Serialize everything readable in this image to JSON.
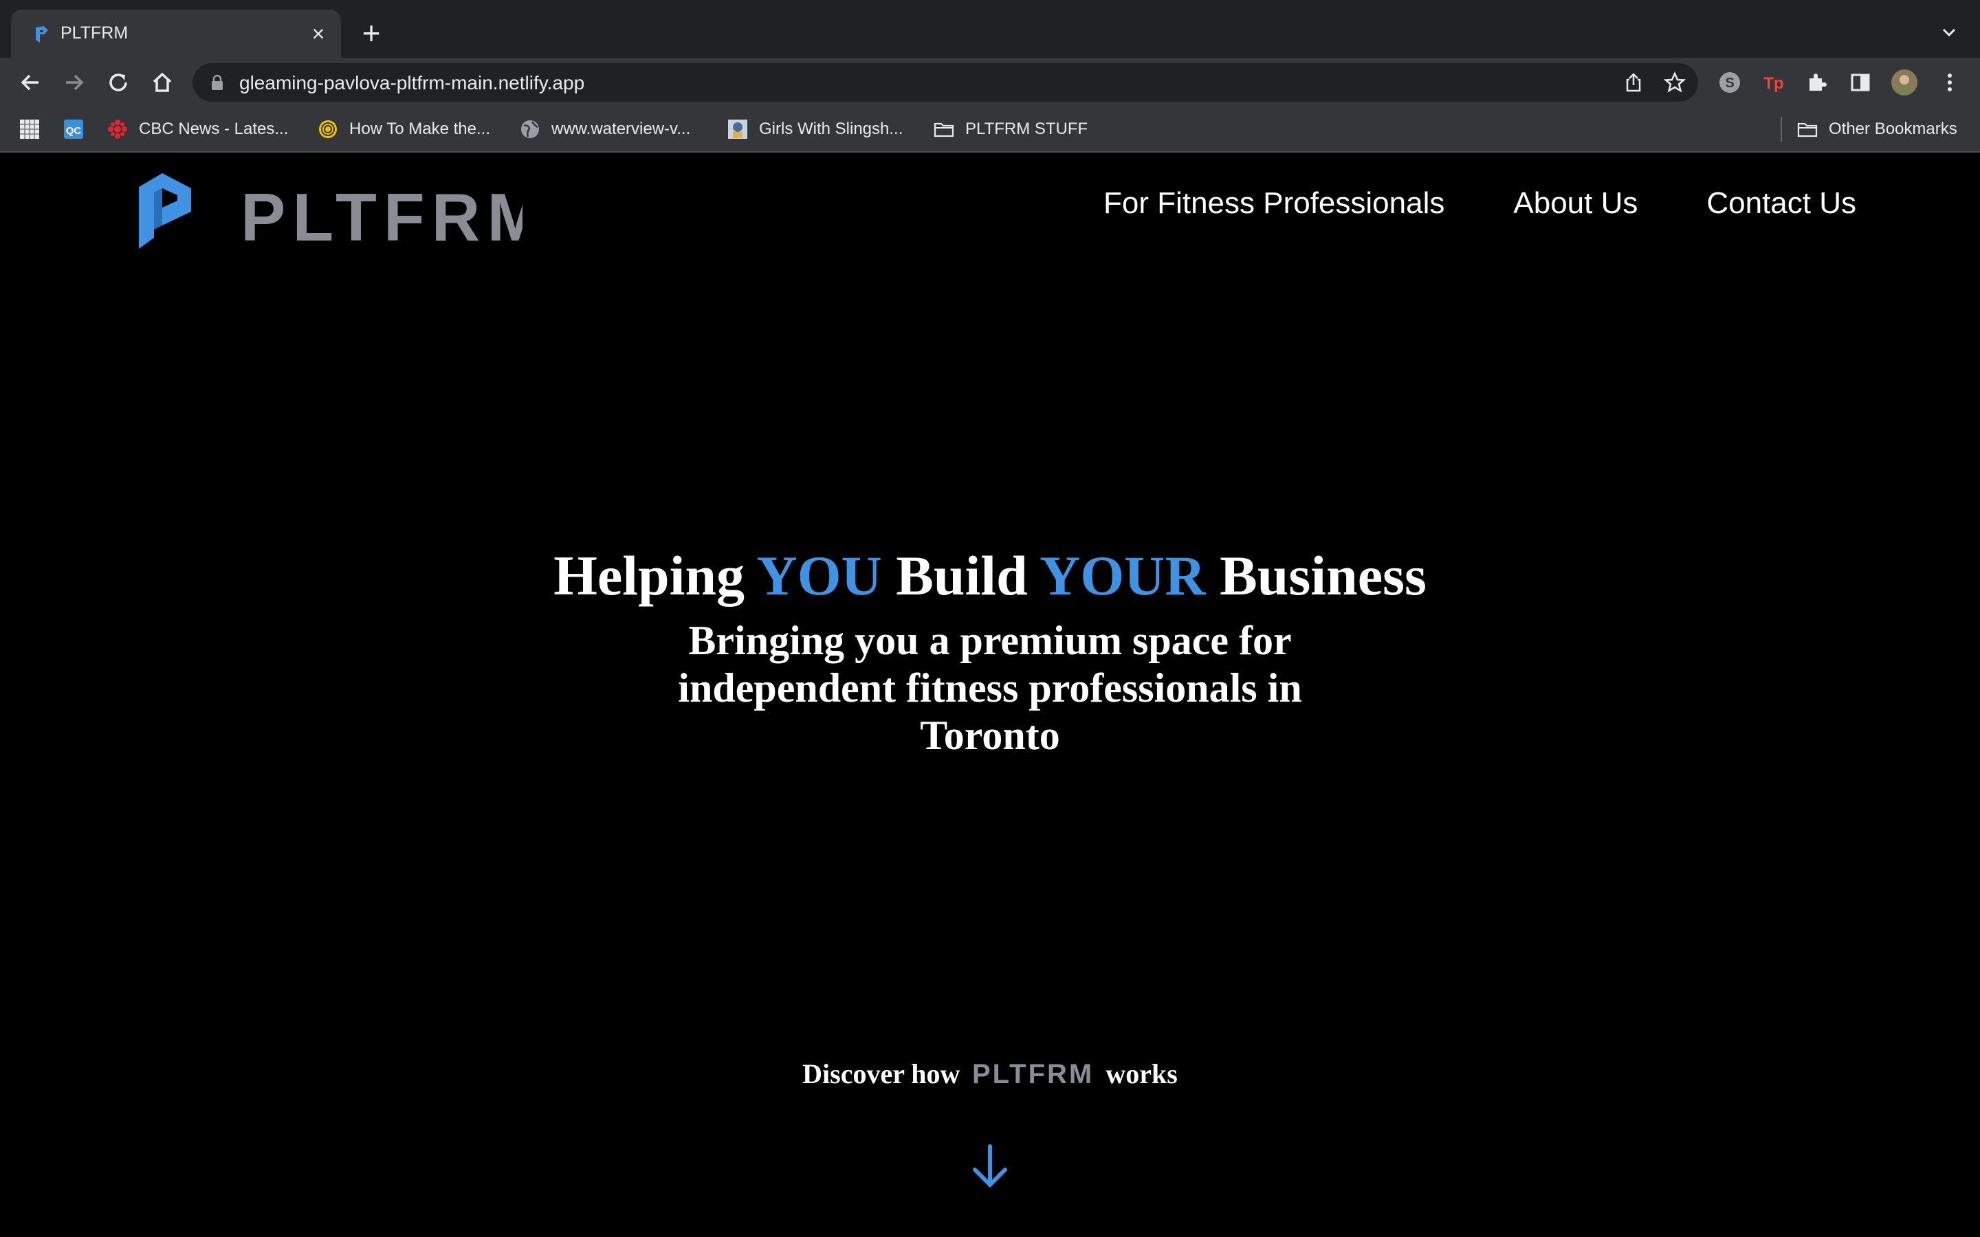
{
  "browser": {
    "tab": {
      "title": "PLTFRM"
    },
    "url": "gleaming-pavlova-pltfrm-main.netlify.app",
    "bookmarks": [
      {
        "label": "",
        "icon": "grid-favicon-icon"
      },
      {
        "label": "",
        "icon": "qc-favicon-icon"
      },
      {
        "label": "CBC News - Lates...",
        "icon": "cbc-favicon-icon"
      },
      {
        "label": "How To Make the...",
        "icon": "spiral-favicon-icon"
      },
      {
        "label": "www.waterview-v...",
        "icon": "globe-icon"
      },
      {
        "label": "Girls With Slingsh...",
        "icon": "slingshot-favicon-icon"
      },
      {
        "label": "PLTFRM STUFF",
        "icon": "folder-icon"
      }
    ],
    "other_bookmarks": "Other Bookmarks"
  },
  "site": {
    "brand": "PLTFRM",
    "accent_color": "#3f93e2",
    "logo_gray": "#8a8e94",
    "nav": {
      "fitness_pros": "For Fitness Professionals",
      "about": "About Us",
      "contact": "Contact Us"
    },
    "hero": {
      "title_1": "Helping ",
      "title_you": "YOU",
      "title_2": " Build ",
      "title_your": "YOUR",
      "title_3": " Business",
      "subtitle": "Bringing you a premium space for independent fitness professionals in Toronto"
    },
    "discover": {
      "before": "Discover how",
      "after": "works"
    }
  }
}
